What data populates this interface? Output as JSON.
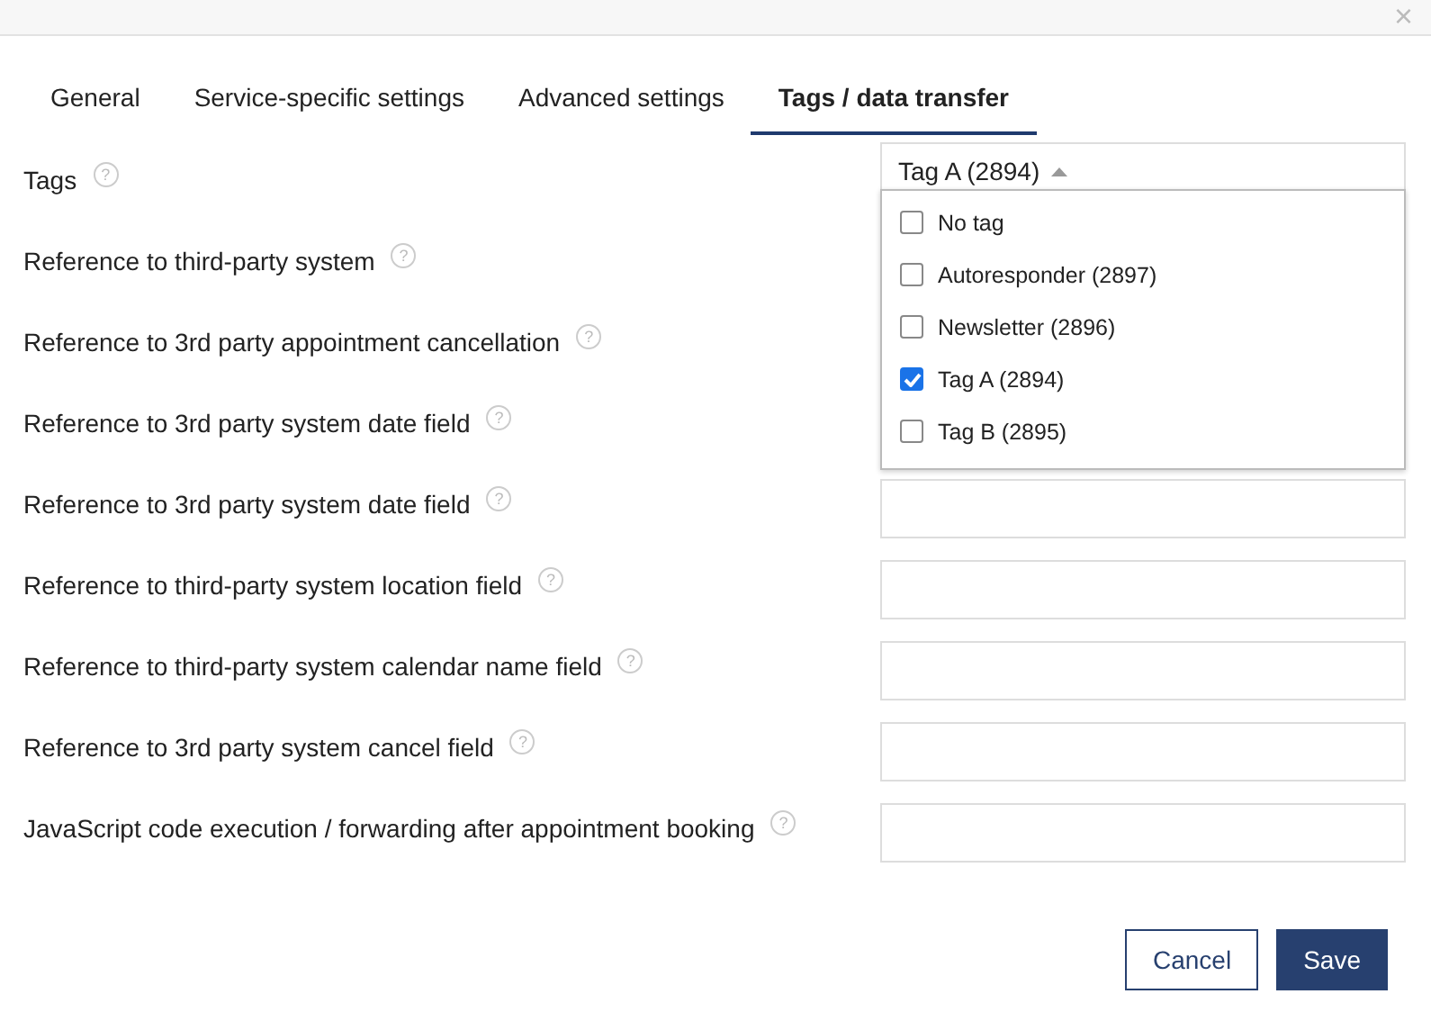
{
  "window": {
    "close": "×"
  },
  "tabs": [
    {
      "label": "General",
      "selected": false
    },
    {
      "label": "Service-specific settings",
      "selected": false
    },
    {
      "label": "Advanced settings",
      "selected": false
    },
    {
      "label": "Tags / data transfer",
      "selected": true
    }
  ],
  "tags": {
    "label": "Tags",
    "help": "?",
    "value": "Tag A (2894)",
    "expanded": true,
    "options": [
      {
        "label": "No tag",
        "checked": false
      },
      {
        "label": "Autoresponder (2897)",
        "checked": false
      },
      {
        "label": "Newsletter (2896)",
        "checked": false
      },
      {
        "label": "Tag A (2894)",
        "checked": true
      },
      {
        "label": "Tag B (2895)",
        "checked": false
      }
    ]
  },
  "fields": [
    {
      "label": "Reference to third-party system",
      "help": "?",
      "kind": "covered"
    },
    {
      "label": "Reference to 3rd party appointment cancellation",
      "help": "?",
      "kind": "covered"
    },
    {
      "label": "Reference to 3rd party system date field",
      "help": "?",
      "kind": "covered"
    },
    {
      "label": "Reference to 3rd party system date field",
      "help": "?",
      "kind": "text"
    },
    {
      "label": "Reference to third-party system location field",
      "help": "?",
      "kind": "text"
    },
    {
      "label": "Reference to third-party system calendar name field",
      "help": "?",
      "kind": "text"
    },
    {
      "label": "Reference to 3rd party system cancel field",
      "help": "?",
      "kind": "text"
    },
    {
      "label": "JavaScript code execution / forwarding after appointment booking",
      "help": "?",
      "kind": "text"
    }
  ],
  "buttons": [
    {
      "label": "Cancel",
      "kind": "secondary"
    },
    {
      "label": "Save",
      "kind": "primary"
    }
  ]
}
